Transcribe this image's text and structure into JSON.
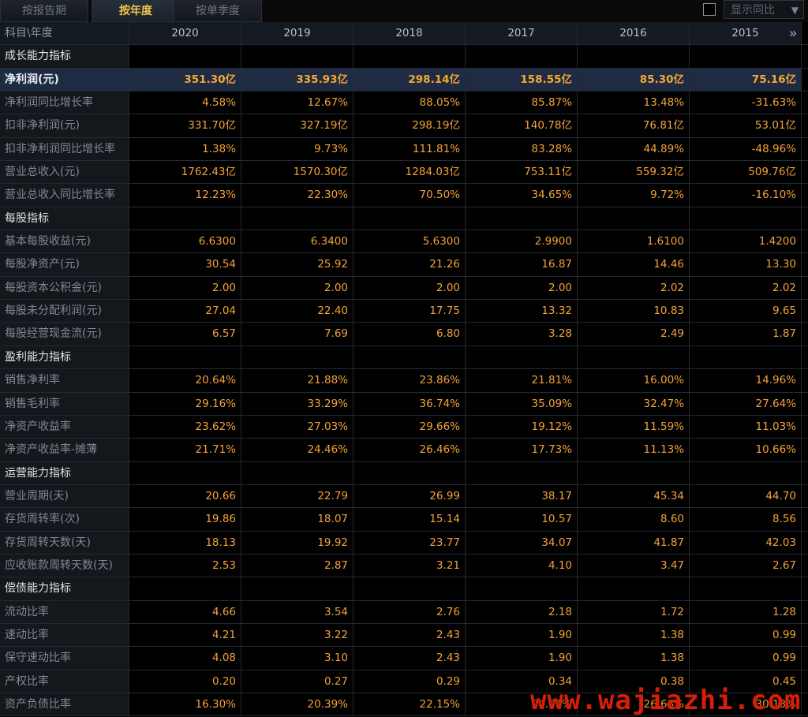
{
  "tabs": [
    {
      "label": "按报告期",
      "active": false
    },
    {
      "label": "按年度",
      "active": true
    },
    {
      "label": "按单季度",
      "active": false
    }
  ],
  "controls": {
    "yoy_label": "显示同比",
    "checkbox_checked": false
  },
  "header": {
    "subject_label": "科目\\年度",
    "years": [
      "2020",
      "2019",
      "2018",
      "2017",
      "2016",
      "2015"
    ]
  },
  "rows": [
    {
      "type": "section",
      "label": "成长能力指标",
      "values": [
        "",
        "",
        "",
        "",
        "",
        ""
      ]
    },
    {
      "type": "highlight",
      "label": "净利润(元)",
      "values": [
        "351.30亿",
        "335.93亿",
        "298.14亿",
        "158.55亿",
        "85.30亿",
        "75.16亿"
      ]
    },
    {
      "type": "data",
      "label": "净利润同比增长率",
      "values": [
        "4.58%",
        "12.67%",
        "88.05%",
        "85.87%",
        "13.48%",
        "-31.63%"
      ]
    },
    {
      "type": "data",
      "label": "扣非净利润(元)",
      "values": [
        "331.70亿",
        "327.19亿",
        "298.19亿",
        "140.78亿",
        "76.81亿",
        "53.01亿"
      ]
    },
    {
      "type": "data",
      "label": "扣非净利润同比增长率",
      "values": [
        "1.38%",
        "9.73%",
        "111.81%",
        "83.28%",
        "44.89%",
        "-48.96%"
      ]
    },
    {
      "type": "data",
      "label": "营业总收入(元)",
      "values": [
        "1762.43亿",
        "1570.30亿",
        "1284.03亿",
        "753.11亿",
        "559.32亿",
        "509.76亿"
      ]
    },
    {
      "type": "data",
      "label": "营业总收入同比增长率",
      "values": [
        "12.23%",
        "22.30%",
        "70.50%",
        "34.65%",
        "9.72%",
        "-16.10%"
      ]
    },
    {
      "type": "section",
      "label": "每股指标",
      "values": [
        "",
        "",
        "",
        "",
        "",
        ""
      ]
    },
    {
      "type": "data",
      "label": "基本每股收益(元)",
      "values": [
        "6.6300",
        "6.3400",
        "5.6300",
        "2.9900",
        "1.6100",
        "1.4200"
      ]
    },
    {
      "type": "data",
      "label": "每股净资产(元)",
      "values": [
        "30.54",
        "25.92",
        "21.26",
        "16.87",
        "14.46",
        "13.30"
      ]
    },
    {
      "type": "data",
      "label": "每股资本公积金(元)",
      "values": [
        "2.00",
        "2.00",
        "2.00",
        "2.00",
        "2.02",
        "2.02"
      ]
    },
    {
      "type": "data",
      "label": "每股未分配利润(元)",
      "values": [
        "27.04",
        "22.40",
        "17.75",
        "13.32",
        "10.83",
        "9.65"
      ]
    },
    {
      "type": "data",
      "label": "每股经营现金流(元)",
      "values": [
        "6.57",
        "7.69",
        "6.80",
        "3.28",
        "2.49",
        "1.87"
      ]
    },
    {
      "type": "section",
      "label": "盈利能力指标",
      "values": [
        "",
        "",
        "",
        "",
        "",
        ""
      ]
    },
    {
      "type": "data",
      "label": "销售净利率",
      "values": [
        "20.64%",
        "21.88%",
        "23.86%",
        "21.81%",
        "16.00%",
        "14.96%"
      ]
    },
    {
      "type": "data",
      "label": "销售毛利率",
      "values": [
        "29.16%",
        "33.29%",
        "36.74%",
        "35.09%",
        "32.47%",
        "27.64%"
      ]
    },
    {
      "type": "data",
      "label": "净资产收益率",
      "values": [
        "23.62%",
        "27.03%",
        "29.66%",
        "19.12%",
        "11.59%",
        "11.03%"
      ]
    },
    {
      "type": "data",
      "label": "净资产收益率-摊薄",
      "values": [
        "21.71%",
        "24.46%",
        "26.46%",
        "17.73%",
        "11.13%",
        "10.66%"
      ]
    },
    {
      "type": "section",
      "label": "运营能力指标",
      "values": [
        "",
        "",
        "",
        "",
        "",
        ""
      ]
    },
    {
      "type": "data",
      "label": "营业周期(天)",
      "values": [
        "20.66",
        "22.79",
        "26.99",
        "38.17",
        "45.34",
        "44.70"
      ]
    },
    {
      "type": "data",
      "label": "存货周转率(次)",
      "values": [
        "19.86",
        "18.07",
        "15.14",
        "10.57",
        "8.60",
        "8.56"
      ]
    },
    {
      "type": "data",
      "label": "存货周转天数(天)",
      "values": [
        "18.13",
        "19.92",
        "23.77",
        "34.07",
        "41.87",
        "42.03"
      ]
    },
    {
      "type": "data",
      "label": "应收账款周转天数(天)",
      "values": [
        "2.53",
        "2.87",
        "3.21",
        "4.10",
        "3.47",
        "2.67"
      ]
    },
    {
      "type": "section",
      "label": "偿债能力指标",
      "values": [
        "",
        "",
        "",
        "",
        "",
        ""
      ]
    },
    {
      "type": "data",
      "label": "流动比率",
      "values": [
        "4.66",
        "3.54",
        "2.76",
        "2.18",
        "1.72",
        "1.28"
      ]
    },
    {
      "type": "data",
      "label": "速动比率",
      "values": [
        "4.21",
        "3.22",
        "2.43",
        "1.90",
        "1.38",
        "0.99"
      ]
    },
    {
      "type": "data",
      "label": "保守速动比率",
      "values": [
        "4.08",
        "3.10",
        "2.43",
        "1.90",
        "1.38",
        "0.99"
      ]
    },
    {
      "type": "data",
      "label": "产权比率",
      "values": [
        "0.20",
        "0.27",
        "0.29",
        "0.34",
        "0.38",
        "0.45"
      ]
    },
    {
      "type": "data",
      "label": "资产负债比率",
      "values": [
        "16.30%",
        "20.39%",
        "22.15%",
        "24.71%",
        "26.68%",
        "30.13%"
      ]
    }
  ],
  "watermark": "www.wajiazhi.com"
}
